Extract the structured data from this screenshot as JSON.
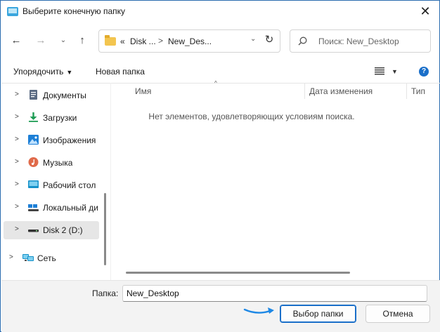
{
  "window": {
    "title": "Выберите конечную папку",
    "close_glyph": "✕"
  },
  "nav": {
    "back_glyph": "←",
    "forward_glyph": "→",
    "recent_glyph": "⌄",
    "up_glyph": "↑"
  },
  "address": {
    "overflow": "«",
    "segments": [
      "Disk ...",
      "New_Des..."
    ],
    "separator": ">",
    "dropdown_glyph": "⌄",
    "refresh_glyph": "↻"
  },
  "search": {
    "placeholder": "Поиск: New_Desktop"
  },
  "toolbar": {
    "organize_label": "Упорядочить",
    "organize_arrow": "▼",
    "new_folder_label": "Новая папка",
    "view_chev": "▼",
    "help_label": "?"
  },
  "sidebar": {
    "items": [
      {
        "label": "Документы",
        "icon": "documents-icon",
        "selected": false
      },
      {
        "label": "Загрузки",
        "icon": "downloads-icon",
        "selected": false
      },
      {
        "label": "Изображения",
        "icon": "pictures-icon",
        "selected": false
      },
      {
        "label": "Музыка",
        "icon": "music-icon",
        "selected": false
      },
      {
        "label": "Рабочий стол",
        "icon": "desktop-icon",
        "selected": false
      },
      {
        "label": "Локальный ди",
        "icon": "local-disk-icon",
        "selected": false
      },
      {
        "label": "Disk 2 (D:)",
        "icon": "drive-icon",
        "selected": true
      },
      {
        "label": "Сеть",
        "icon": "network-icon",
        "selected": false
      }
    ],
    "chevron_glyph": ">"
  },
  "file_list": {
    "columns": [
      "Имя",
      "Дата изменения",
      "Тип"
    ],
    "sort_caret": "^",
    "empty_message": "Нет элементов, удовлетворяющих условиям поиска."
  },
  "footer": {
    "folder_label": "Папка:",
    "folder_value": "New_Desktop",
    "select_button": "Выбор папки",
    "cancel_button": "Отмена"
  },
  "colors": {
    "accent": "#1a6fc9",
    "annotation_arrow": "#1e88e5",
    "folder": "#f3c54f"
  }
}
